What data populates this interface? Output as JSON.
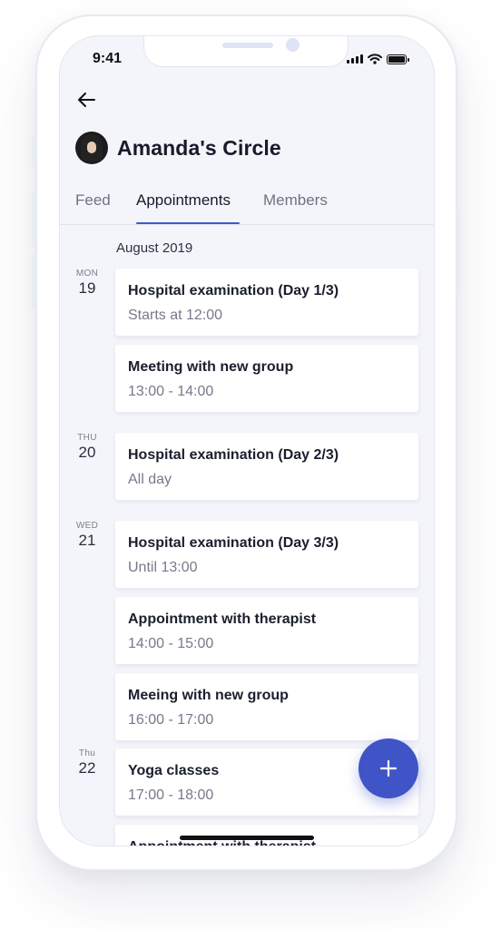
{
  "status": {
    "time": "9:41"
  },
  "header": {
    "title": "Amanda's Circle"
  },
  "tabs": [
    {
      "label": "Feed",
      "active": false
    },
    {
      "label": "Appointments",
      "active": true
    },
    {
      "label": "Members",
      "active": false
    }
  ],
  "month": "August 2019",
  "days": [
    {
      "dow": "MON",
      "day": "19"
    },
    {
      "dow": "THU",
      "day": "20"
    },
    {
      "dow": "WED",
      "day": "21"
    },
    {
      "dow": "Thu",
      "day": "22"
    }
  ],
  "appointments": [
    {
      "title": "Hospital examination (Day 1/3)",
      "subtitle": "Starts at 12:00"
    },
    {
      "title": "Meeting with new group",
      "subtitle": "13:00 - 14:00"
    },
    {
      "title": "Hospital examination (Day 2/3)",
      "subtitle": "All day"
    },
    {
      "title": "Hospital examination (Day 3/3)",
      "subtitle": "Until 13:00"
    },
    {
      "title": "Appointment with therapist",
      "subtitle": "14:00 - 15:00"
    },
    {
      "title": "Meeing with new group",
      "subtitle": "16:00 - 17:00"
    },
    {
      "title": "Yoga classes",
      "subtitle": "17:00 - 18:00"
    },
    {
      "title": "Appointment with therapist",
      "subtitle": ""
    }
  ],
  "colors": {
    "accent": "#3f54c6",
    "background": "#f4f5fa",
    "card": "#ffffff"
  }
}
